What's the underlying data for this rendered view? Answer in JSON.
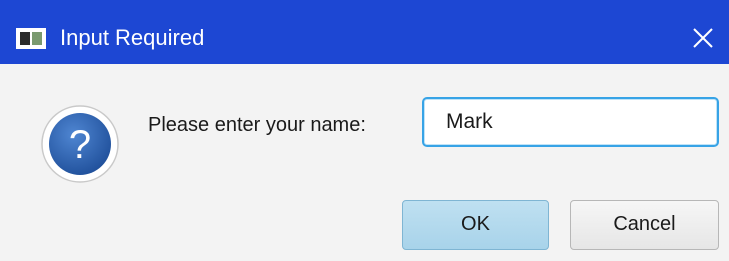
{
  "window": {
    "title": "Input Required"
  },
  "dialog": {
    "prompt": "Please enter your name:",
    "name_value": "Mark",
    "question_glyph": "?",
    "ok_label": "OK",
    "cancel_label": "Cancel"
  },
  "icons": {
    "app": "window-app-icon",
    "close": "close-icon",
    "question": "question-icon"
  },
  "colors": {
    "titlebar": "#1d47d3",
    "input_focus_border": "#37a3e6",
    "question_circle": "#2a5da8",
    "ok_button": "#a8d3ea"
  }
}
